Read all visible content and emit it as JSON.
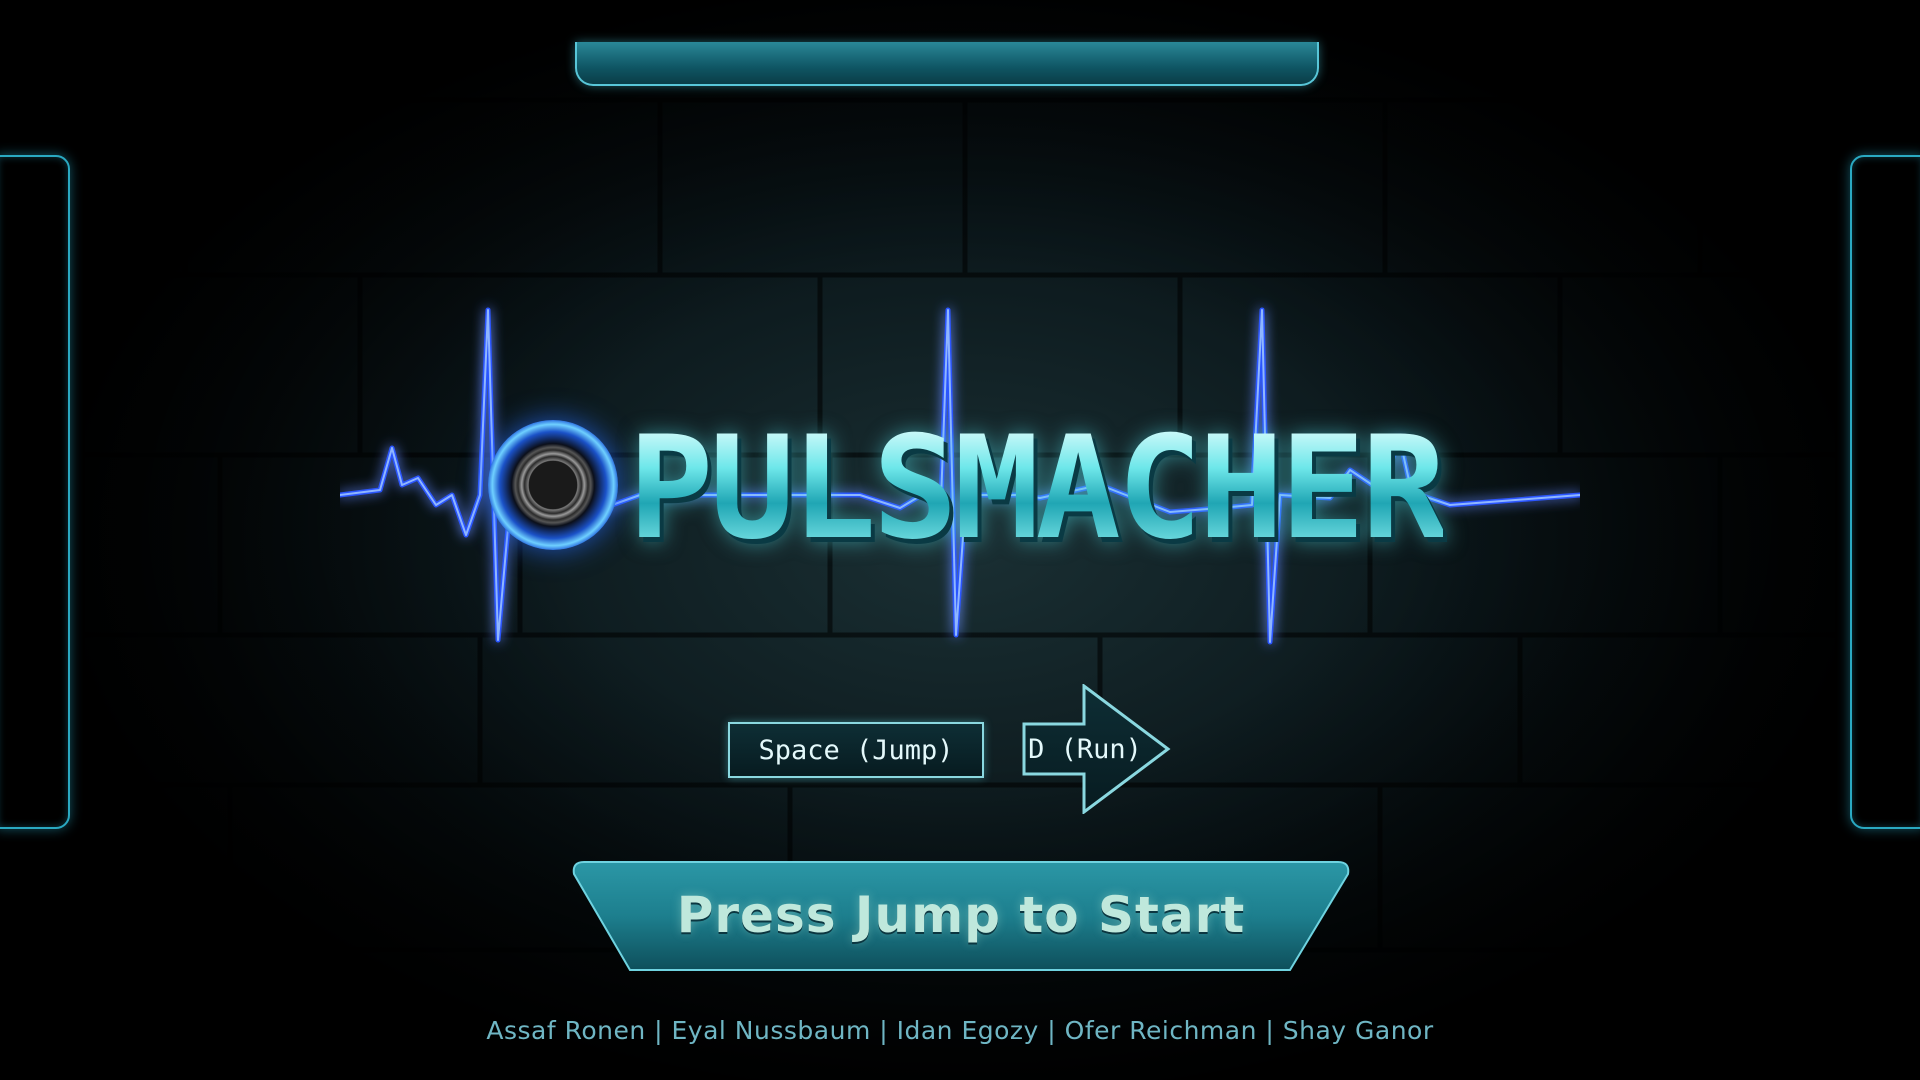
{
  "game": {
    "title": "PULSMACHER"
  },
  "controls": {
    "jump_key": "Space (Jump)",
    "run_key": "D (Run)"
  },
  "start_prompt": "Press Jump to Start",
  "credits": "Assaf Ronen | Eyal Nussbaum | Idan Egozy | Ofer Reichman | Shay Ganor",
  "colors": {
    "accent_cyan": "#57e3e8",
    "frame_teal": "#2aa9c2",
    "pulse_blue": "#2a55ff",
    "banner_teal": "#1d7f8e",
    "credits_text": "#6fb6c4"
  },
  "icons": {
    "logo_disc": "speaker-disc-icon",
    "run_arrow": "right-arrow-icon",
    "pulse_wave": "heartbeat-pulse-icon"
  }
}
